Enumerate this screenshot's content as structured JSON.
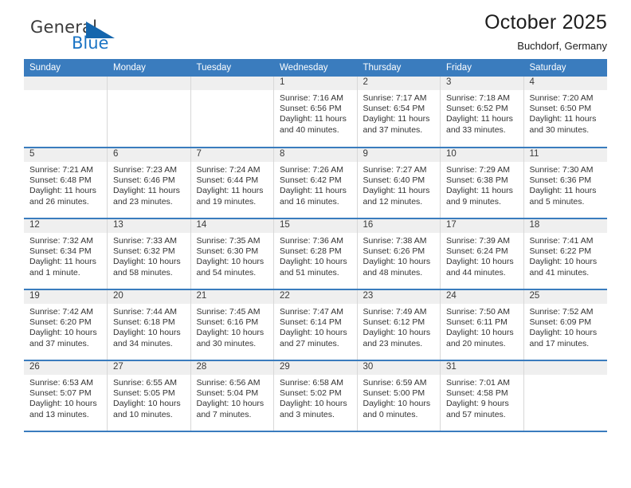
{
  "brand": {
    "name_top": "General",
    "name_bottom": "Blue",
    "triangle_icon": "brand-triangle-icon",
    "accent_color": "#1566ad"
  },
  "header": {
    "title": "October 2025",
    "subtitle": "Buchdorf, Germany"
  },
  "theme": {
    "header_blue": "#3a7cbe",
    "date_band_gray": "#efefef",
    "text": "#333333"
  },
  "weekday_headers": [
    "Sunday",
    "Monday",
    "Tuesday",
    "Wednesday",
    "Thursday",
    "Friday",
    "Saturday"
  ],
  "labels": {
    "sunrise": "Sunrise:",
    "sunset": "Sunset:",
    "daylight": "Daylight:"
  },
  "weeks": [
    [
      {
        "day": "",
        "sunrise": "",
        "sunset": "",
        "daylight": "",
        "daylight2": ""
      },
      {
        "day": "",
        "sunrise": "",
        "sunset": "",
        "daylight": "",
        "daylight2": ""
      },
      {
        "day": "",
        "sunrise": "",
        "sunset": "",
        "daylight": "",
        "daylight2": ""
      },
      {
        "day": "1",
        "sunrise": "Sunrise: 7:16 AM",
        "sunset": "Sunset: 6:56 PM",
        "daylight": "Daylight: 11 hours",
        "daylight2": "and 40 minutes."
      },
      {
        "day": "2",
        "sunrise": "Sunrise: 7:17 AM",
        "sunset": "Sunset: 6:54 PM",
        "daylight": "Daylight: 11 hours",
        "daylight2": "and 37 minutes."
      },
      {
        "day": "3",
        "sunrise": "Sunrise: 7:18 AM",
        "sunset": "Sunset: 6:52 PM",
        "daylight": "Daylight: 11 hours",
        "daylight2": "and 33 minutes."
      },
      {
        "day": "4",
        "sunrise": "Sunrise: 7:20 AM",
        "sunset": "Sunset: 6:50 PM",
        "daylight": "Daylight: 11 hours",
        "daylight2": "and 30 minutes."
      }
    ],
    [
      {
        "day": "5",
        "sunrise": "Sunrise: 7:21 AM",
        "sunset": "Sunset: 6:48 PM",
        "daylight": "Daylight: 11 hours",
        "daylight2": "and 26 minutes."
      },
      {
        "day": "6",
        "sunrise": "Sunrise: 7:23 AM",
        "sunset": "Sunset: 6:46 PM",
        "daylight": "Daylight: 11 hours",
        "daylight2": "and 23 minutes."
      },
      {
        "day": "7",
        "sunrise": "Sunrise: 7:24 AM",
        "sunset": "Sunset: 6:44 PM",
        "daylight": "Daylight: 11 hours",
        "daylight2": "and 19 minutes."
      },
      {
        "day": "8",
        "sunrise": "Sunrise: 7:26 AM",
        "sunset": "Sunset: 6:42 PM",
        "daylight": "Daylight: 11 hours",
        "daylight2": "and 16 minutes."
      },
      {
        "day": "9",
        "sunrise": "Sunrise: 7:27 AM",
        "sunset": "Sunset: 6:40 PM",
        "daylight": "Daylight: 11 hours",
        "daylight2": "and 12 minutes."
      },
      {
        "day": "10",
        "sunrise": "Sunrise: 7:29 AM",
        "sunset": "Sunset: 6:38 PM",
        "daylight": "Daylight: 11 hours",
        "daylight2": "and 9 minutes."
      },
      {
        "day": "11",
        "sunrise": "Sunrise: 7:30 AM",
        "sunset": "Sunset: 6:36 PM",
        "daylight": "Daylight: 11 hours",
        "daylight2": "and 5 minutes."
      }
    ],
    [
      {
        "day": "12",
        "sunrise": "Sunrise: 7:32 AM",
        "sunset": "Sunset: 6:34 PM",
        "daylight": "Daylight: 11 hours",
        "daylight2": "and 1 minute."
      },
      {
        "day": "13",
        "sunrise": "Sunrise: 7:33 AM",
        "sunset": "Sunset: 6:32 PM",
        "daylight": "Daylight: 10 hours",
        "daylight2": "and 58 minutes."
      },
      {
        "day": "14",
        "sunrise": "Sunrise: 7:35 AM",
        "sunset": "Sunset: 6:30 PM",
        "daylight": "Daylight: 10 hours",
        "daylight2": "and 54 minutes."
      },
      {
        "day": "15",
        "sunrise": "Sunrise: 7:36 AM",
        "sunset": "Sunset: 6:28 PM",
        "daylight": "Daylight: 10 hours",
        "daylight2": "and 51 minutes."
      },
      {
        "day": "16",
        "sunrise": "Sunrise: 7:38 AM",
        "sunset": "Sunset: 6:26 PM",
        "daylight": "Daylight: 10 hours",
        "daylight2": "and 48 minutes."
      },
      {
        "day": "17",
        "sunrise": "Sunrise: 7:39 AM",
        "sunset": "Sunset: 6:24 PM",
        "daylight": "Daylight: 10 hours",
        "daylight2": "and 44 minutes."
      },
      {
        "day": "18",
        "sunrise": "Sunrise: 7:41 AM",
        "sunset": "Sunset: 6:22 PM",
        "daylight": "Daylight: 10 hours",
        "daylight2": "and 41 minutes."
      }
    ],
    [
      {
        "day": "19",
        "sunrise": "Sunrise: 7:42 AM",
        "sunset": "Sunset: 6:20 PM",
        "daylight": "Daylight: 10 hours",
        "daylight2": "and 37 minutes."
      },
      {
        "day": "20",
        "sunrise": "Sunrise: 7:44 AM",
        "sunset": "Sunset: 6:18 PM",
        "daylight": "Daylight: 10 hours",
        "daylight2": "and 34 minutes."
      },
      {
        "day": "21",
        "sunrise": "Sunrise: 7:45 AM",
        "sunset": "Sunset: 6:16 PM",
        "daylight": "Daylight: 10 hours",
        "daylight2": "and 30 minutes."
      },
      {
        "day": "22",
        "sunrise": "Sunrise: 7:47 AM",
        "sunset": "Sunset: 6:14 PM",
        "daylight": "Daylight: 10 hours",
        "daylight2": "and 27 minutes."
      },
      {
        "day": "23",
        "sunrise": "Sunrise: 7:49 AM",
        "sunset": "Sunset: 6:12 PM",
        "daylight": "Daylight: 10 hours",
        "daylight2": "and 23 minutes."
      },
      {
        "day": "24",
        "sunrise": "Sunrise: 7:50 AM",
        "sunset": "Sunset: 6:11 PM",
        "daylight": "Daylight: 10 hours",
        "daylight2": "and 20 minutes."
      },
      {
        "day": "25",
        "sunrise": "Sunrise: 7:52 AM",
        "sunset": "Sunset: 6:09 PM",
        "daylight": "Daylight: 10 hours",
        "daylight2": "and 17 minutes."
      }
    ],
    [
      {
        "day": "26",
        "sunrise": "Sunrise: 6:53 AM",
        "sunset": "Sunset: 5:07 PM",
        "daylight": "Daylight: 10 hours",
        "daylight2": "and 13 minutes."
      },
      {
        "day": "27",
        "sunrise": "Sunrise: 6:55 AM",
        "sunset": "Sunset: 5:05 PM",
        "daylight": "Daylight: 10 hours",
        "daylight2": "and 10 minutes."
      },
      {
        "day": "28",
        "sunrise": "Sunrise: 6:56 AM",
        "sunset": "Sunset: 5:04 PM",
        "daylight": "Daylight: 10 hours",
        "daylight2": "and 7 minutes."
      },
      {
        "day": "29",
        "sunrise": "Sunrise: 6:58 AM",
        "sunset": "Sunset: 5:02 PM",
        "daylight": "Daylight: 10 hours",
        "daylight2": "and 3 minutes."
      },
      {
        "day": "30",
        "sunrise": "Sunrise: 6:59 AM",
        "sunset": "Sunset: 5:00 PM",
        "daylight": "Daylight: 10 hours",
        "daylight2": "and 0 minutes."
      },
      {
        "day": "31",
        "sunrise": "Sunrise: 7:01 AM",
        "sunset": "Sunset: 4:58 PM",
        "daylight": "Daylight: 9 hours",
        "daylight2": "and 57 minutes."
      },
      {
        "day": "",
        "sunrise": "",
        "sunset": "",
        "daylight": "",
        "daylight2": ""
      }
    ]
  ]
}
